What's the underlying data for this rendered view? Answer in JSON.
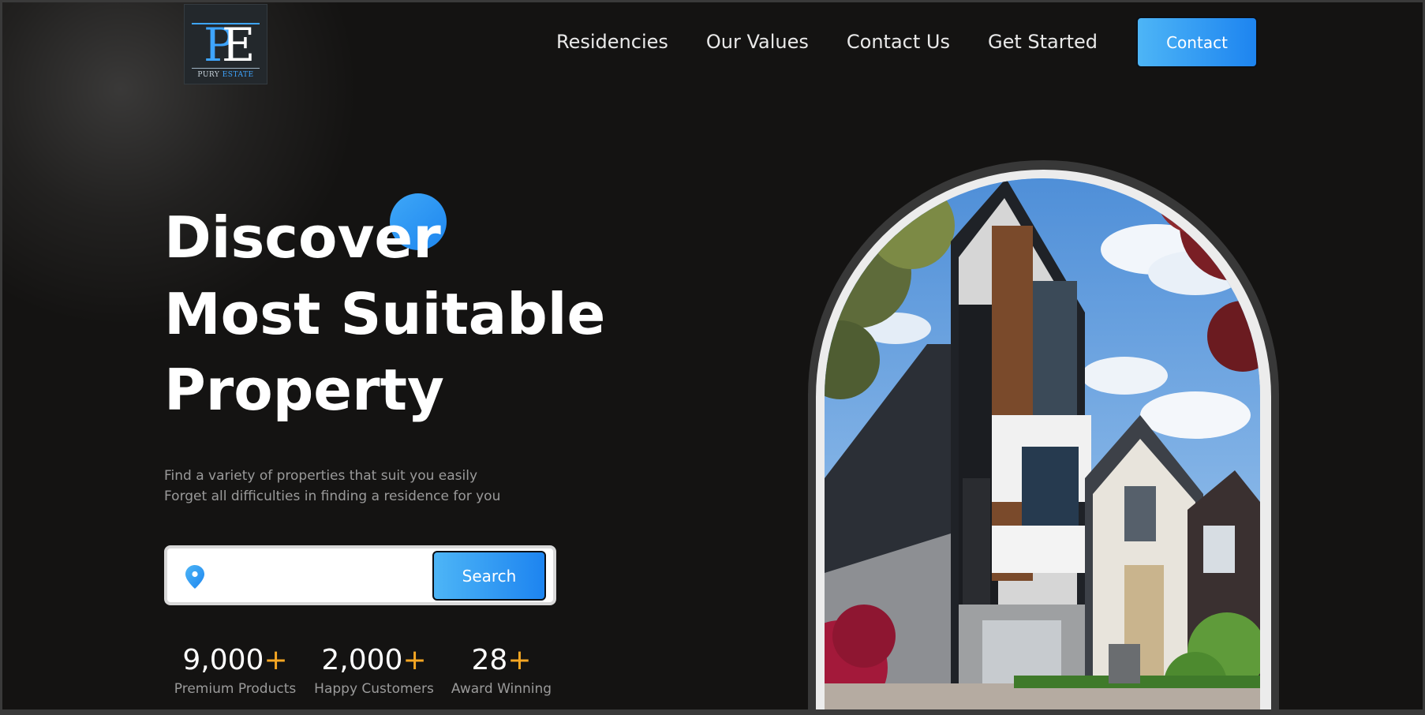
{
  "brand": {
    "monogram_p": "P",
    "monogram_e": "E",
    "tagline_part1": "PURY",
    "tagline_part2": "ESTATE"
  },
  "nav": {
    "items": [
      {
        "label": "Residencies"
      },
      {
        "label": "Our Values"
      },
      {
        "label": "Contact Us"
      },
      {
        "label": "Get Started"
      }
    ],
    "contact_label": "Contact"
  },
  "hero": {
    "title_line1": "Discover",
    "title_line2": "Most Suitable",
    "title_line3": "Property",
    "subtitle_line1": "Find a variety of properties that suit you easily",
    "subtitle_line2": "Forget all difficulties in finding a residence for you",
    "search": {
      "value": "",
      "button_label": "Search",
      "pin_icon": "location-pin-icon"
    },
    "stats": [
      {
        "value": "9,000",
        "suffix": "+",
        "label": "Premium Products"
      },
      {
        "value": "2,000",
        "suffix": "+",
        "label": "Happy Customers"
      },
      {
        "value": "28",
        "suffix": "+",
        "label": "Award Winning"
      }
    ]
  },
  "colors": {
    "accent_blue": "#1e86ef",
    "accent_light_blue": "#4db5f6",
    "stat_plus": "#f5a623",
    "background": "#141312"
  }
}
